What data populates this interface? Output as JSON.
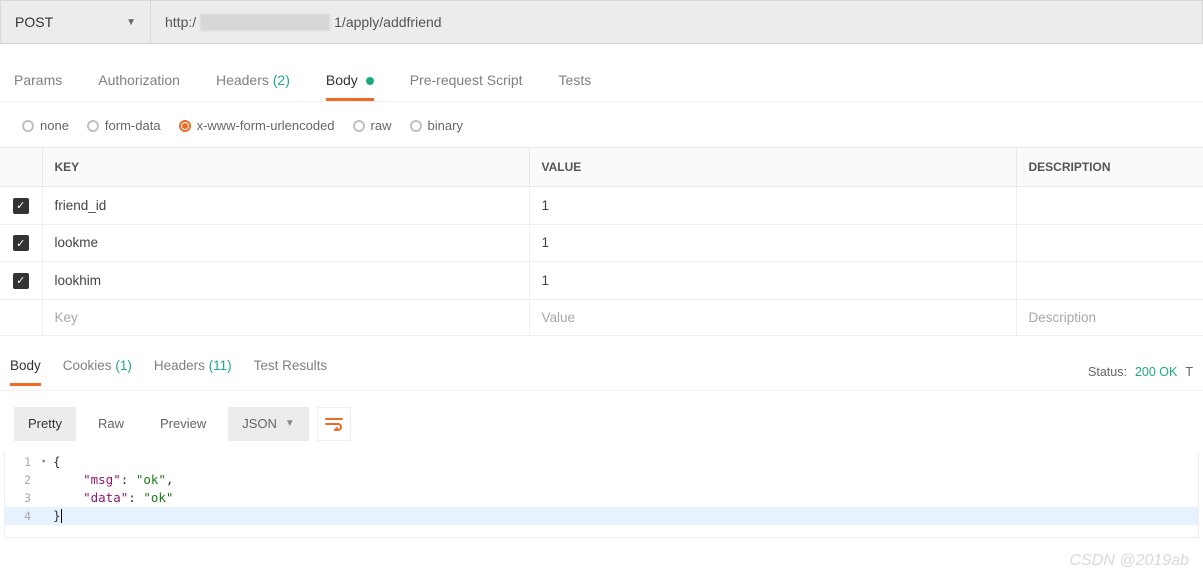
{
  "request": {
    "method": "POST",
    "url_prefix": "http:/",
    "url_suffix_1": "1/apply/addfriend"
  },
  "tabs": {
    "params": "Params",
    "auth": "Authorization",
    "headers": "Headers",
    "headers_count": "(2)",
    "body": "Body",
    "prereq": "Pre-request Script",
    "tests": "Tests"
  },
  "body_type": {
    "none": "none",
    "form": "form-data",
    "xwww": "x-www-form-urlencoded",
    "raw": "raw",
    "binary": "binary"
  },
  "table": {
    "head_key": "KEY",
    "head_value": "VALUE",
    "head_desc": "DESCRIPTION",
    "rows": [
      {
        "key": "friend_id",
        "value": "1",
        "desc": ""
      },
      {
        "key": "lookme",
        "value": "1",
        "desc": ""
      },
      {
        "key": "lookhim",
        "value": "1",
        "desc": ""
      }
    ],
    "ph_key": "Key",
    "ph_value": "Value",
    "ph_desc": "Description"
  },
  "response_tabs": {
    "body": "Body",
    "cookies": "Cookies",
    "cookies_count": "(1)",
    "headers": "Headers",
    "headers_count": "(11)",
    "tests": "Test Results"
  },
  "status": {
    "label": "Status:",
    "code": "200 OK",
    "trail": "T"
  },
  "viewer": {
    "pretty": "Pretty",
    "raw": "Raw",
    "preview": "Preview",
    "format": "JSON"
  },
  "json_lines": {
    "l1": "{",
    "l2_indent": "    ",
    "l2_k": "\"msg\"",
    "l2_sep": ": ",
    "l2_v": "\"ok\"",
    "l2_end": ",",
    "l3_k": "\"data\"",
    "l3_v": "\"ok\"",
    "l4": "}"
  },
  "watermark": "CSDN @2019ab"
}
